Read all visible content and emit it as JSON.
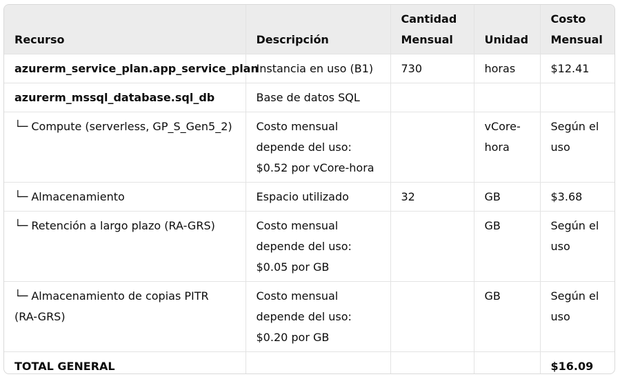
{
  "headers": [
    "Recurso",
    "Descripción",
    "Cantidad Mensual",
    "Unidad",
    "Costo Mensual"
  ],
  "rows": [
    {
      "recurso": "azurerm_service_plan.app_service_plan",
      "descripcion": "Instancia en uso (B1)",
      "cantidad": "730",
      "unidad": "horas",
      "costo": "$12.41",
      "bold": true
    },
    {
      "recurso": "azurerm_mssql_database.sql_db",
      "descripcion": "Base de datos SQL",
      "cantidad": "",
      "unidad": "",
      "costo": "",
      "bold": true
    },
    {
      "recurso": "└─ Compute (serverless, GP_S_Gen5_2)",
      "descripcion": "Costo mensual depende del uso: $0.52 por vCore-hora",
      "cantidad": "",
      "unidad": "vCore-hora",
      "costo": "Según el uso",
      "bold": false
    },
    {
      "recurso": "└─ Almacenamiento",
      "descripcion": "Espacio utilizado",
      "cantidad": "32",
      "unidad": "GB",
      "costo": "$3.68",
      "bold": false
    },
    {
      "recurso": "└─ Retención a largo plazo (RA-GRS)",
      "descripcion": "Costo mensual depende del uso: $0.05 por GB",
      "cantidad": "",
      "unidad": "GB",
      "costo": "Según el uso",
      "bold": false
    },
    {
      "recurso": "└─ Almacenamiento de copias PITR (RA-GRS)",
      "descripcion": "Costo mensual depende del uso: $0.20 por GB",
      "cantidad": "",
      "unidad": "GB",
      "costo": "Según el uso",
      "bold": false
    },
    {
      "recurso": "TOTAL GENERAL",
      "descripcion": "",
      "cantidad": "",
      "unidad": "",
      "costo": "$16.09",
      "bold": true
    }
  ]
}
